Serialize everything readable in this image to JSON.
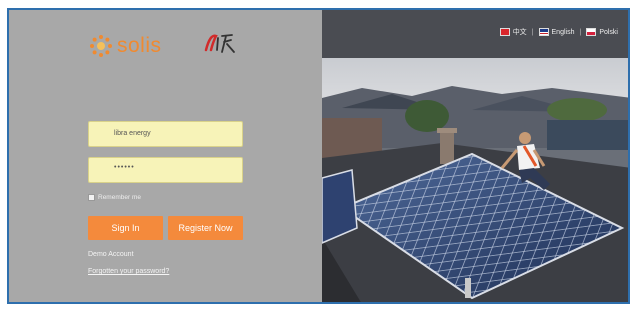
{
  "brand": {
    "name": "solis"
  },
  "languages": [
    {
      "code": "cn",
      "label": "中文"
    },
    {
      "code": "us",
      "label": "English"
    },
    {
      "code": "pl",
      "label": "Polski"
    }
  ],
  "login": {
    "username_value": "libra energy",
    "password_value": "••••••",
    "remember_label": "Remember me",
    "sign_in_label": "Sign In",
    "register_label": "Register Now",
    "demo_link": "Demo Account",
    "forgot_link": "Forgotten your password?"
  },
  "colors": {
    "accent": "#f48a3c",
    "input_bg": "#f7f3b8",
    "panel": "#a8a8a8",
    "topbar": "#4a4c52"
  }
}
